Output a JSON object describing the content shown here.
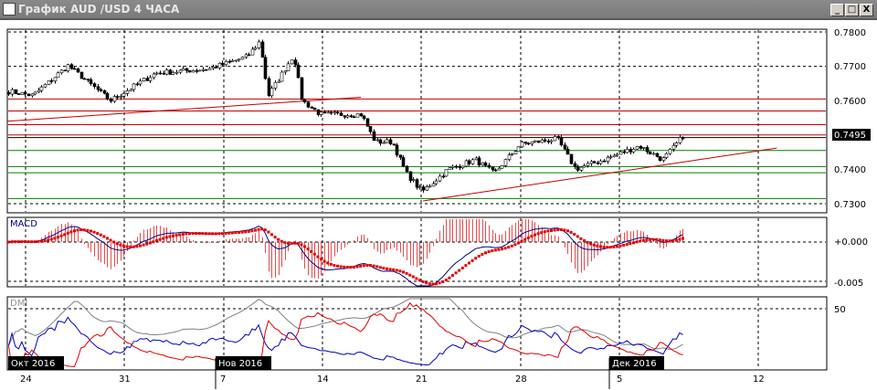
{
  "window": {
    "title": "График AUD /USD  4 ЧАСА",
    "minimize": "_",
    "maximize": "□",
    "close": "X"
  },
  "price_axis": {
    "labels": [
      "0.7800",
      "0.7700",
      "0.7600",
      "0.7400",
      "0.7300"
    ],
    "current": "0.7495"
  },
  "macd": {
    "label": "MACD",
    "axis": [
      "+0.000",
      "-0.005"
    ]
  },
  "dmi": {
    "label": "DMI",
    "axis": [
      "50"
    ]
  },
  "date_axis": {
    "days": [
      "24",
      "31",
      "7",
      "14",
      "21",
      "28",
      "5",
      "12"
    ],
    "months": [
      "Окт 2016",
      "Нов 2016",
      "Дек 2016"
    ]
  },
  "colors": {
    "up": "#ffffff",
    "down": "#000000",
    "resistance": "#c00000",
    "support": "#008000",
    "macd_line": "#000080",
    "signal": "#e00000",
    "adx": "#808080",
    "plus_di": "#0000c0",
    "minus_di": "#e00000"
  },
  "chart_data": {
    "type": "candlestick",
    "symbol": "AUD/USD",
    "timeframe": "4H",
    "ylim": [
      0.729,
      0.781
    ],
    "price_keypoints_day_price": [
      [
        -1.2,
        0.7627
      ],
      [
        0.5,
        0.7615
      ],
      [
        3,
        0.7702
      ],
      [
        6,
        0.76
      ],
      [
        9.2,
        0.768
      ],
      [
        13,
        0.7693
      ],
      [
        15.7,
        0.7728
      ],
      [
        16.6,
        0.7773
      ],
      [
        17.2,
        0.7614
      ],
      [
        19,
        0.7733
      ],
      [
        19.6,
        0.76
      ],
      [
        20.9,
        0.756
      ],
      [
        23.8,
        0.756
      ],
      [
        24.8,
        0.748
      ],
      [
        26,
        0.748
      ],
      [
        27,
        0.7388
      ],
      [
        28.1,
        0.7335
      ],
      [
        30,
        0.7401
      ],
      [
        31.9,
        0.7428
      ],
      [
        33.2,
        0.7388
      ],
      [
        35.1,
        0.7473
      ],
      [
        37.7,
        0.7489
      ],
      [
        39,
        0.7401
      ],
      [
        41,
        0.7428
      ],
      [
        43.5,
        0.7468
      ],
      [
        45.2,
        0.7428
      ],
      [
        46.7,
        0.75
      ]
    ],
    "resistance_levels": [
      0.7605,
      0.757,
      0.753,
      0.75
    ],
    "support_levels": [
      0.7455,
      0.7408,
      0.739,
      0.7315
    ],
    "trendlines_day_price": [
      [
        [
          -1.3,
          0.754
        ],
        [
          23.8,
          0.761
        ]
      ],
      [
        [
          28.2,
          0.7308
        ],
        [
          53.3,
          0.7462
        ]
      ]
    ],
    "macd_range": [
      -0.0065,
      0.003
    ],
    "dmi_range": [
      0,
      60
    ]
  }
}
